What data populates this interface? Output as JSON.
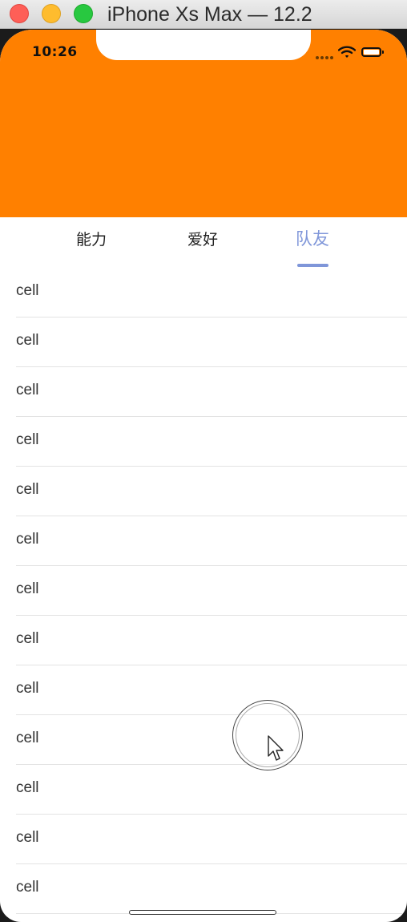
{
  "window": {
    "title": "iPhone Xs Max — 12.2"
  },
  "status_bar": {
    "time": "10:26",
    "icons": [
      "signal-icon",
      "wifi-icon",
      "battery-icon"
    ]
  },
  "header": {
    "color": "#ff8000"
  },
  "tabs": {
    "items": [
      {
        "label": "能力"
      },
      {
        "label": "爱好"
      },
      {
        "label": "队友"
      }
    ],
    "selected_index": 2,
    "accent_color": "#7f96d9"
  },
  "cells": [
    {
      "label": "cell"
    },
    {
      "label": "cell"
    },
    {
      "label": "cell"
    },
    {
      "label": "cell"
    },
    {
      "label": "cell"
    },
    {
      "label": "cell"
    },
    {
      "label": "cell"
    },
    {
      "label": "cell"
    },
    {
      "label": "cell"
    },
    {
      "label": "cell"
    },
    {
      "label": "cell"
    },
    {
      "label": "cell"
    },
    {
      "label": "cell"
    }
  ]
}
